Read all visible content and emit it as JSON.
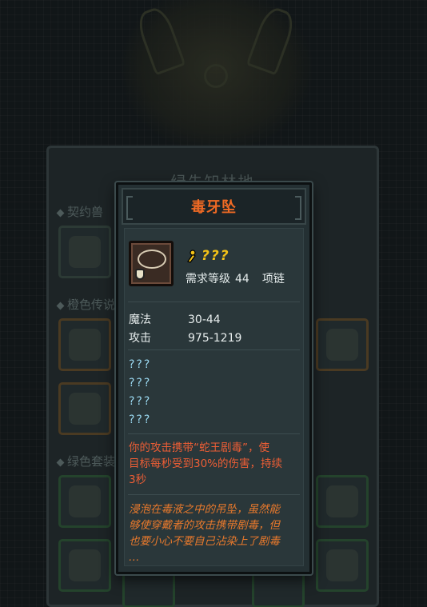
{
  "background": {
    "window_title": "绿先知林地",
    "sections": [
      {
        "label": "契约兽"
      },
      {
        "label": "橙色传说"
      },
      {
        "label": "绿色套装"
      }
    ]
  },
  "tooltip": {
    "title": "毒牙坠",
    "item_icon": "fang-necklace-icon",
    "item_name": "???",
    "requirement_label": "需求等级",
    "requirement_level": "44",
    "slot_type": "项链",
    "stats": [
      {
        "label": "魔法",
        "value": "30-44"
      },
      {
        "label": "攻击",
        "value": "975-1219"
      }
    ],
    "unknown_attributes": [
      "???",
      "???",
      "???",
      "???"
    ],
    "effect_lines": [
      "你的攻击携带“蛇王剧毒”，使",
      "目标每秒受到30%的伤害，持续",
      "3秒"
    ],
    "lore_lines": [
      "浸泡在毒液之中的吊坠，虽然能",
      "够使穿戴者的攻击携带剧毒，但",
      "也要小心不要自己沾染上了剧毒",
      "…"
    ]
  },
  "colors": {
    "title": "#f06a24",
    "item_name": "#f2c218",
    "unknown": "#9ad8f0",
    "effect": "#ee5e35",
    "lore": "#e8792c"
  }
}
